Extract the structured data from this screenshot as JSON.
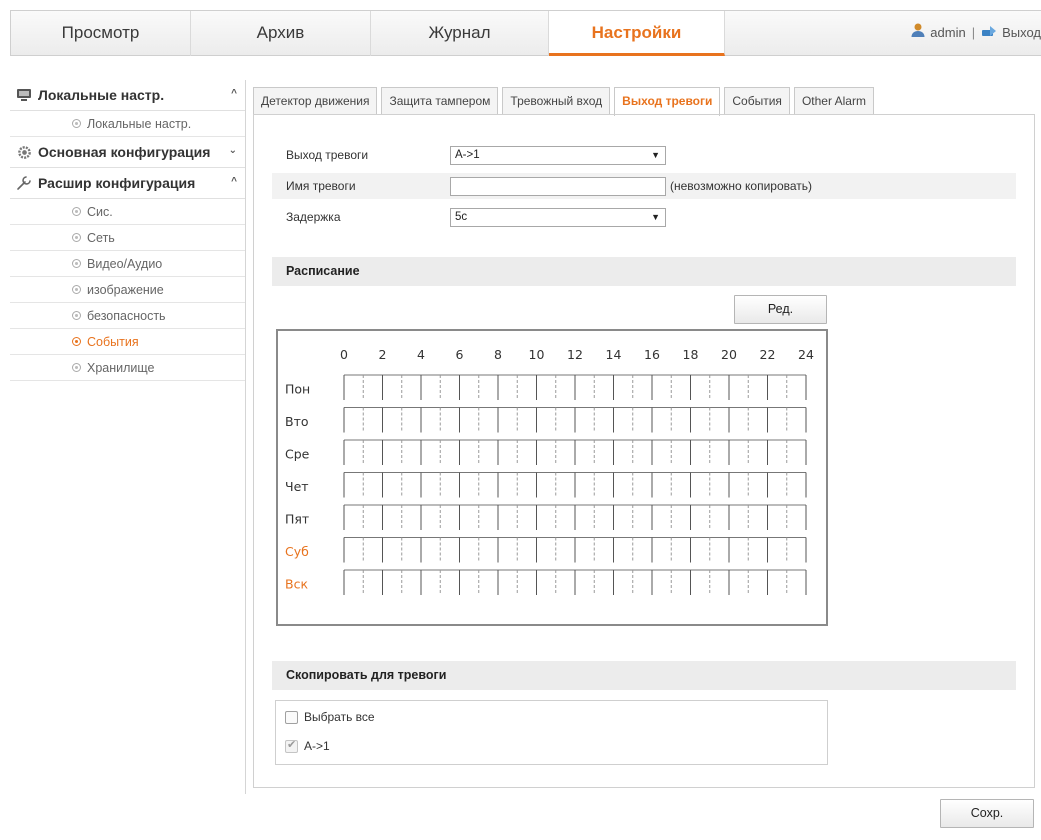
{
  "topnav": {
    "tabs": [
      {
        "label": "Просмотр",
        "active": false
      },
      {
        "label": "Архив",
        "active": false
      },
      {
        "label": "Журнал",
        "active": false
      },
      {
        "label": "Настройки",
        "active": true
      }
    ],
    "user": "admin",
    "separator": "|",
    "logout": "Выход",
    "user_icon": "user-icon",
    "logout_icon": "logout-icon"
  },
  "sidebar": {
    "groups": [
      {
        "label": "Локальные настр.",
        "icon": "monitor-icon",
        "expanded": true,
        "items": [
          {
            "label": "Локальные настр.",
            "active": false
          }
        ]
      },
      {
        "label": "Основная конфигурация",
        "icon": "gear-icon",
        "expanded": false,
        "items": []
      },
      {
        "label": "Расшир конфигурация",
        "icon": "wrench-icon",
        "expanded": true,
        "items": [
          {
            "label": "Сис.",
            "active": false
          },
          {
            "label": "Сеть",
            "active": false
          },
          {
            "label": "Видео/Аудио",
            "active": false
          },
          {
            "label": "изображение",
            "active": false
          },
          {
            "label": "безопасность",
            "active": false
          },
          {
            "label": "События",
            "active": true
          },
          {
            "label": "Хранилище",
            "active": false
          }
        ]
      }
    ]
  },
  "content_tabs": [
    {
      "label": "Детектор движения",
      "active": false
    },
    {
      "label": "Защита тампером",
      "active": false
    },
    {
      "label": "Тревожный вход",
      "active": false
    },
    {
      "label": "Выход тревоги",
      "active": true
    },
    {
      "label": "События",
      "active": false
    },
    {
      "label": "Other Alarm",
      "active": false
    }
  ],
  "form": {
    "alarm_output_label": "Выход тревоги",
    "alarm_output_value": "A->1",
    "alarm_name_label": "Имя тревоги",
    "alarm_name_value": "",
    "alarm_name_hint": "(невозможно копировать)",
    "delay_label": "Задержка",
    "delay_value": "5c"
  },
  "schedule": {
    "section_title": "Расписание",
    "edit_button": "Ред.",
    "hours": [
      "0",
      "2",
      "4",
      "6",
      "8",
      "10",
      "12",
      "14",
      "16",
      "18",
      "20",
      "22",
      "24"
    ],
    "days": [
      {
        "label": "Пон",
        "weekend": false
      },
      {
        "label": "Вто",
        "weekend": false
      },
      {
        "label": "Сре",
        "weekend": false
      },
      {
        "label": "Чет",
        "weekend": false
      },
      {
        "label": "Пят",
        "weekend": false
      },
      {
        "label": "Суб",
        "weekend": true
      },
      {
        "label": "Вск",
        "weekend": true
      }
    ]
  },
  "copy": {
    "section_title": "Скопировать для тревоги",
    "select_all_label": "Выбрать все",
    "select_all_checked": false,
    "items": [
      {
        "label": "A->1",
        "checked": true,
        "disabled": true
      }
    ]
  },
  "save_button": "Сохр.",
  "colors": {
    "accent": "#e8731e",
    "weekend": "#e8731e",
    "section_bg": "#ececec"
  }
}
